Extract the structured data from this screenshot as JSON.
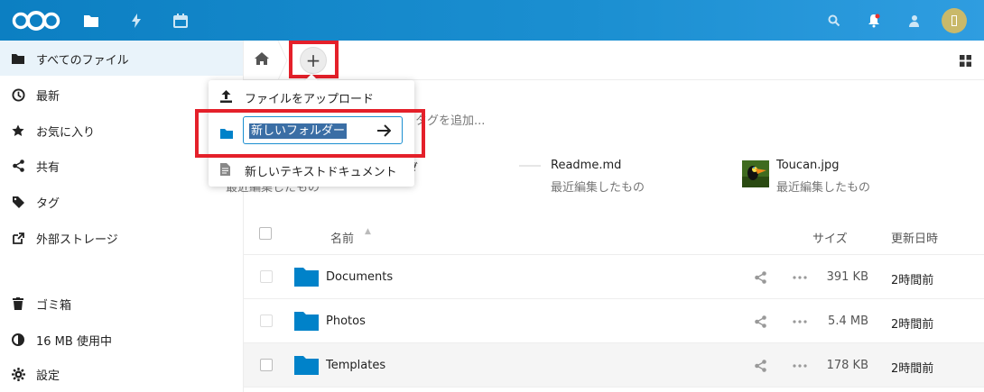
{
  "header": {
    "icons": [
      "nextcloud-logo",
      "files-icon",
      "activity-icon",
      "calendar-icon",
      "search-icon",
      "notifications-icon",
      "contacts-icon",
      "avatar"
    ],
    "colors": {
      "bar": "#0c7fc2",
      "accent": "#1b8fd1"
    }
  },
  "sidebar": {
    "items": [
      {
        "label": "すべてのファイル",
        "icon": "folder-icon",
        "active": true
      },
      {
        "label": "最新",
        "icon": "clock-icon"
      },
      {
        "label": "お気に入り",
        "icon": "star-icon"
      },
      {
        "label": "共有",
        "icon": "share-icon"
      },
      {
        "label": "タグ",
        "icon": "tag-icon"
      },
      {
        "label": "外部ストレージ",
        "icon": "external-link-icon"
      }
    ],
    "bottom": [
      {
        "label": "ゴミ箱",
        "icon": "trash-icon"
      },
      {
        "label": "16 MB 使用中",
        "icon": "quota-icon"
      },
      {
        "label": "設定",
        "icon": "gear-icon"
      }
    ]
  },
  "controls": {
    "new_button": "+"
  },
  "new_menu": {
    "upload_label": "ファイルをアップロード",
    "folder_input_value": "新しいフォルダー",
    "text_doc_label": "新しいテキストドキュメント"
  },
  "tag_hint": "タグを追加...",
  "recent": [
    {
      "name": "",
      "name_tail": "ダ",
      "sub": "最近編集したもの"
    },
    {
      "name": "Readme.md",
      "sub": "最近編集したもの"
    },
    {
      "name": "Toucan.jpg",
      "sub": "最近編集したもの"
    }
  ],
  "table": {
    "headers": {
      "name": "名前",
      "size": "サイズ",
      "modified": "更新日時"
    },
    "rows": [
      {
        "name": "Documents",
        "size": "391 KB",
        "modified": "2時間前"
      },
      {
        "name": "Photos",
        "size": "5.4 MB",
        "modified": "2時間前"
      },
      {
        "name": "Templates",
        "size": "178 KB",
        "modified": "2時間前"
      }
    ]
  }
}
